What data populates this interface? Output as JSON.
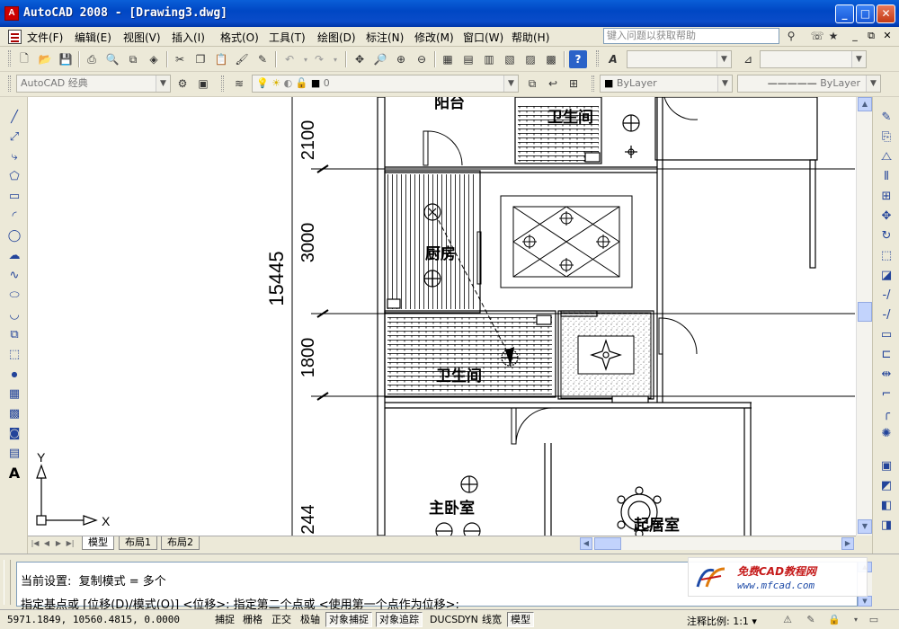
{
  "window": {
    "title": "AutoCAD 2008 - [Drawing3.dwg]",
    "minimize": "_",
    "maximize": "□",
    "close": "✕"
  },
  "menu": {
    "items": [
      "文件(F)",
      "编辑(E)",
      "视图(V)",
      "插入(I)",
      "格式(O)",
      "工具(T)",
      "绘图(D)",
      "标注(N)",
      "修改(M)",
      "窗口(W)",
      "帮助(H)"
    ],
    "help_search_placeholder": "键入问题以获取帮助",
    "mdi_buttons": [
      "_",
      "⧉",
      "✕"
    ]
  },
  "toolbar2": {
    "workspace": "AutoCAD 经典",
    "layer": "0",
    "color": "ByLayer",
    "linetype": "ByLayer"
  },
  "drawing": {
    "rooms": [
      "阳台",
      "卫生间",
      "厨房",
      "卫生间",
      "主卧室",
      "起居室"
    ],
    "dimensions": [
      "2100",
      "3000",
      "1800",
      "244",
      "15445"
    ],
    "axis_x": "X",
    "axis_y": "Y"
  },
  "tabs": {
    "items": [
      "模型",
      "布局1",
      "布局2"
    ],
    "active": "模型"
  },
  "command": {
    "line1": "当前设置:  复制模式 = 多个",
    "line2": "指定基点或 [位移(D)/模式(O)] <位移>: 指定第二个点或 <使用第一个点作为位移>:"
  },
  "watermark": {
    "name": "免费CAD教程网",
    "url": "www.mfcad.com"
  },
  "status": {
    "coords": "5971.1849, 10560.4815, 0.0000",
    "buttons": [
      "捕捉",
      "栅格",
      "正交",
      "极轴",
      "对象捕捉",
      "对象追踪",
      "DUCS",
      "DYN",
      "线宽",
      "模型"
    ],
    "active_buttons": [
      "对象捕捉",
      "对象追踪",
      "模型"
    ],
    "annotation_scale": "注释比例: 1:1 ▾"
  }
}
